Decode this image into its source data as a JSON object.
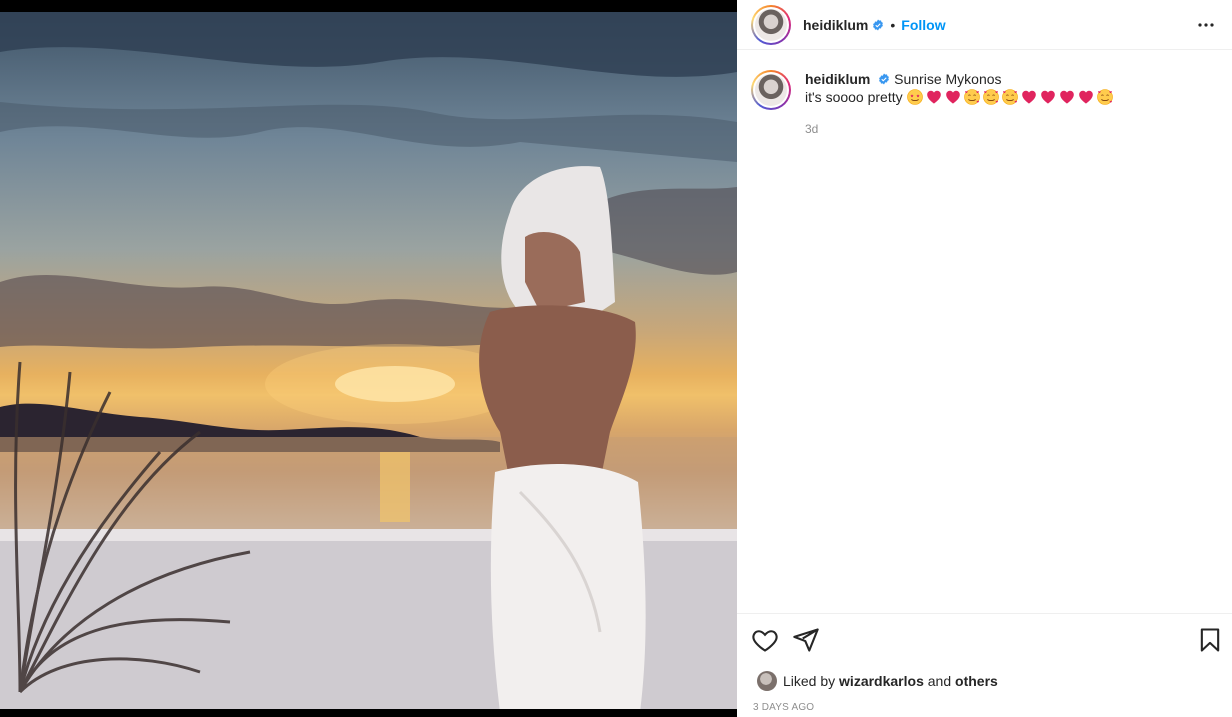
{
  "post": {
    "username": "heidiklum",
    "dot": "•",
    "follow_label": "Follow",
    "caption_title": "Sunrise Mykonos",
    "caption_text": "it's soooo pretty",
    "caption_emojis": [
      "star-struck",
      "heart",
      "heart",
      "smiling-hearts",
      "smiling-hearts",
      "smiling-hearts",
      "heart",
      "heart",
      "heart",
      "heart",
      "smiling-hearts"
    ],
    "relative_time": "3d",
    "liked_by_prefix": "Liked by",
    "liked_by_user": "wizardkarlos",
    "liked_by_and": "and",
    "liked_by_others": "others",
    "date": "3 DAYS AGO"
  },
  "colors": {
    "accent": "#0095f6",
    "verified": "#3897f0",
    "muted": "#8e8e8e"
  }
}
